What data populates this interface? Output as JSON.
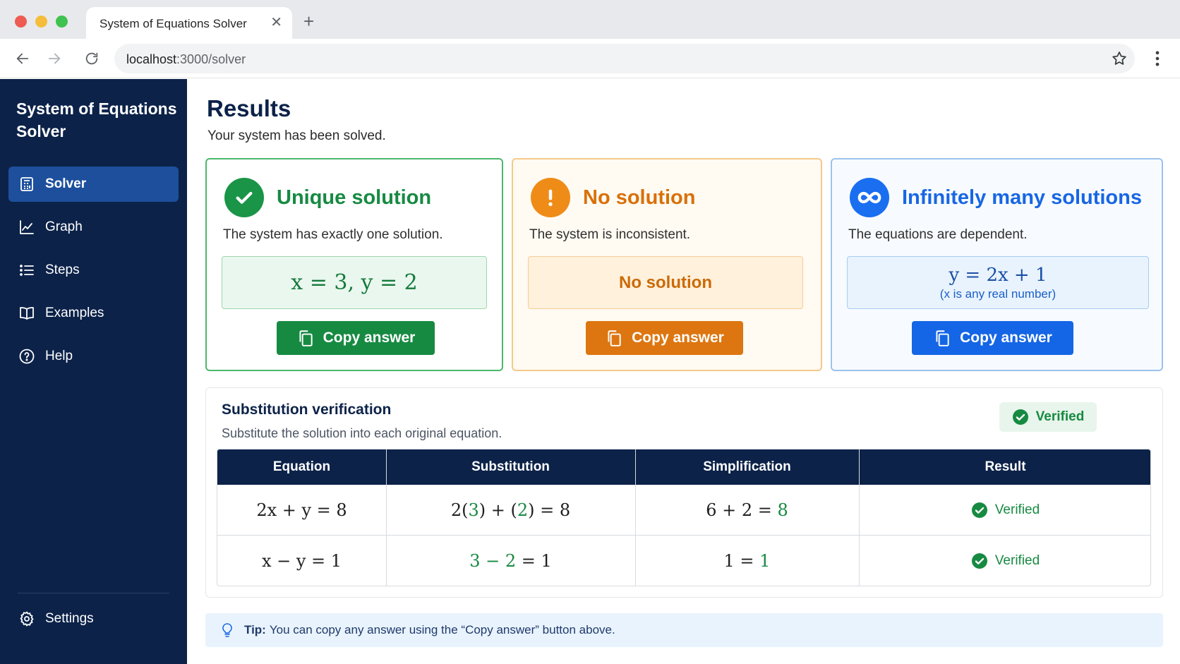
{
  "browser": {
    "tab_title": "System of Equations Solver",
    "close_glyph": "✕",
    "new_tab_glyph": "+",
    "url_host": "localhost",
    "url_path": ":3000/solver"
  },
  "sidebar": {
    "brand": "System of Equations Solver",
    "items": [
      {
        "label": "Solver",
        "icon": "calculator-icon",
        "active": true
      },
      {
        "label": "Graph",
        "icon": "line-chart-icon",
        "active": false
      },
      {
        "label": "Steps",
        "icon": "list-icon",
        "active": false
      },
      {
        "label": "Examples",
        "icon": "book-icon",
        "active": false
      },
      {
        "label": "Help",
        "icon": "help-circle-icon",
        "active": false
      }
    ],
    "settings": {
      "label": "Settings",
      "icon": "gear-icon"
    }
  },
  "page": {
    "title": "Results",
    "subtitle": "Your system has been solved."
  },
  "cards": {
    "unique": {
      "title": "Unique solution",
      "description": "The system has exactly one solution.",
      "answer": "x = 3, y = 2",
      "copy_label": "Copy answer",
      "icon": "check-circle-icon",
      "color": "#178a42"
    },
    "none": {
      "title": "No solution",
      "description": "The system is inconsistent.",
      "answer": "No solution",
      "copy_label": "Copy answer",
      "icon": "exclamation-circle-icon",
      "color": "#dd7610"
    },
    "infinite": {
      "title": "Infinitely many solutions",
      "description": "The equations are dependent.",
      "answer": "y = 2x + 1",
      "answer_note": "(x is any real number)",
      "copy_label": "Copy answer",
      "icon": "infinity-icon",
      "color": "#1566e6"
    }
  },
  "verification": {
    "title": "Substitution verification",
    "subtitle": "Substitute the solution into each original equation.",
    "badge": "Verified",
    "columns": [
      "Equation",
      "Substitution",
      "Simplification",
      "Result"
    ],
    "rows": [
      {
        "equation": "2x + y = 8",
        "substitution": {
          "a": "2(",
          "b": "3",
          "c": ") + (",
          "d": "2",
          "e": ") = 8"
        },
        "simplification": {
          "left": "6 + 2 = ",
          "right": "8"
        },
        "result": "Verified"
      },
      {
        "equation": "x − y = 1",
        "substitution": {
          "a": "3 − 2",
          "b": " = 1"
        },
        "simplification": {
          "left": "1 = ",
          "right": "1"
        },
        "result": "Verified"
      }
    ]
  },
  "tip": {
    "label": "Tip:",
    "text": "You can copy any answer using the “Copy answer” button above."
  }
}
